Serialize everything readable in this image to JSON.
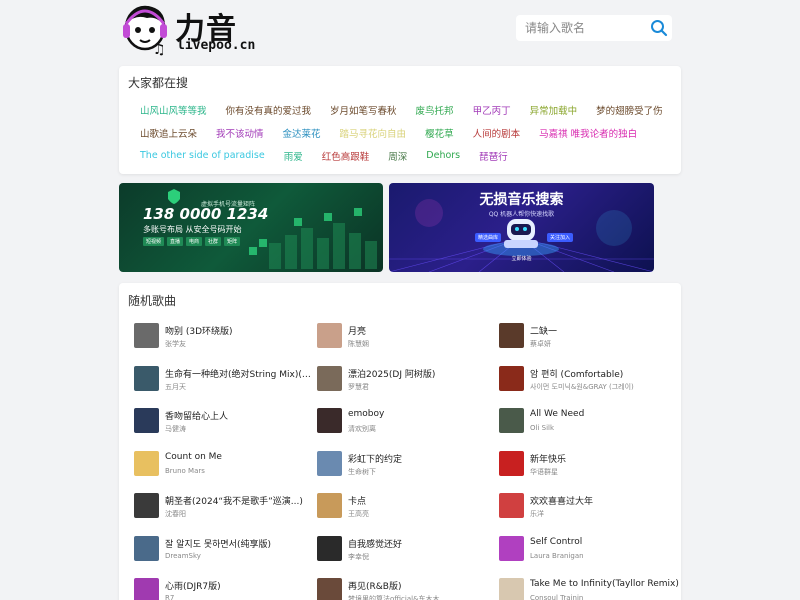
{
  "logo": {
    "cn": "力音",
    "en": "livepoo.cn"
  },
  "search": {
    "placeholder": "请输入歌名"
  },
  "hot": {
    "title": "大家都在搜",
    "rows": [
      [
        {
          "label": "山风山风等等我",
          "color": "#2bb58a"
        },
        {
          "label": "你有没有真的爱过我",
          "color": "#6b4a2c"
        },
        {
          "label": "岁月如笔写春秋",
          "color": "#6b4a2c"
        },
        {
          "label": "废鸟托邦",
          "color": "#2fa84f"
        },
        {
          "label": "甲乙丙丁",
          "color": "#a23bb8"
        },
        {
          "label": "异常加载中",
          "color": "#8aa62c"
        },
        {
          "label": "梦的翅膀受了伤",
          "color": "#6b4a2c"
        }
      ],
      [
        {
          "label": "山歌追上云朵",
          "color": "#6b4a2c"
        },
        {
          "label": "我不该动情",
          "color": "#a23bb8"
        },
        {
          "label": "金达莱花",
          "color": "#2b8fbf"
        },
        {
          "label": "踏马寻花向自由",
          "color": "#d9d27a"
        },
        {
          "label": "樱花草",
          "color": "#2fa84f"
        },
        {
          "label": "人间的剧本",
          "color": "#b83b3b"
        },
        {
          "label": "马嘉祺 唯我论者的独白",
          "color": "#d82bb0"
        }
      ],
      [
        {
          "label": "The other side of paradise",
          "color": "#3ac8e0"
        },
        {
          "label": "雨爱",
          "color": "#2bb58a"
        },
        {
          "label": "红色高跟鞋",
          "color": "#b83b3b"
        },
        {
          "label": "周深",
          "color": "#4a7a4a"
        },
        {
          "label": "Dehors",
          "color": "#2fa84f"
        },
        {
          "label": "琵琶行",
          "color": "#a23bb8"
        }
      ]
    ]
  },
  "songs": {
    "title": "随机歌曲",
    "items": [
      {
        "title": "吻别 (3D环绕版)",
        "artist": "张学友",
        "cover": "#6a6a6a"
      },
      {
        "title": "月亮",
        "artist": "陈慧娴",
        "cover": "#c9a08a"
      },
      {
        "title": "二缺一",
        "artist": "蔡卓妍",
        "cover": "#5a3a2a"
      },
      {
        "title": "生命有一种绝对(绝对String Mix)(Live)",
        "artist": "五月天",
        "cover": "#3a5a6a"
      },
      {
        "title": "漂泊2025(DJ 阿树版)",
        "artist": "罗慧君",
        "cover": "#7a6a5a"
      },
      {
        "title": "암 편히 (Comfortable)",
        "artist": "사이먼 도미닉&원&GRAY (그레이)",
        "cover": "#8a2a1a"
      },
      {
        "title": "香吻留给心上人",
        "artist": "马健涛",
        "cover": "#2a3a5a"
      },
      {
        "title": "emoboy",
        "artist": "清欢别离",
        "cover": "#3a2a2a"
      },
      {
        "title": "All We Need",
        "artist": "Oli Silk",
        "cover": "#4a5a4a"
      },
      {
        "title": "Count on Me",
        "artist": "Bruno Mars",
        "cover": "#e8c060"
      },
      {
        "title": "彩虹下的约定",
        "artist": "生命树下",
        "cover": "#6a8ab0"
      },
      {
        "title": "新年快乐",
        "artist": "华语群星",
        "cover": "#c82020"
      },
      {
        "title": "朝圣者(2024“我不是歌手”巡演...)",
        "artist": "沈春阳",
        "cover": "#3a3a3a"
      },
      {
        "title": "卡点",
        "artist": "王高亮",
        "cover": "#c89a5a"
      },
      {
        "title": "欢欢喜喜过大年",
        "artist": "乐洋",
        "cover": "#d04040"
      },
      {
        "title": "잘 알지도 못하면서(纯享版)",
        "artist": "DreamSky",
        "cover": "#4a6a8a"
      },
      {
        "title": "自我感觉还好",
        "artist": "李幸倪",
        "cover": "#2a2a2a"
      },
      {
        "title": "Self Control",
        "artist": "Laura Branigan",
        "cover": "#b040c0"
      },
      {
        "title": "心雨(DJR7版)",
        "artist": "R7",
        "cover": "#a03ab0"
      },
      {
        "title": "再见(R&B版)",
        "artist": "梦境里的算法official&东木木",
        "cover": "#6a4a3a"
      },
      {
        "title": "Take Me to Infinity(Tayllor Remix)",
        "artist": "Consoul Trainin",
        "cover": "#d8c8b0"
      }
    ]
  },
  "banner_left": {
    "line1": "虚拟手机号流量矩阵",
    "number": "138 0000 1234",
    "line2": "多账号布局 从安全号码开始",
    "tabs": [
      "短视频",
      "直播",
      "电商",
      "社群",
      "矩阵"
    ]
  },
  "banner_right": {
    "title": "无损音乐搜索",
    "subtitle": "QQ 机器人帮你快速找歌",
    "tag_left": "精选曲库",
    "tag_right": "关注加入",
    "cta": "立即体验"
  }
}
